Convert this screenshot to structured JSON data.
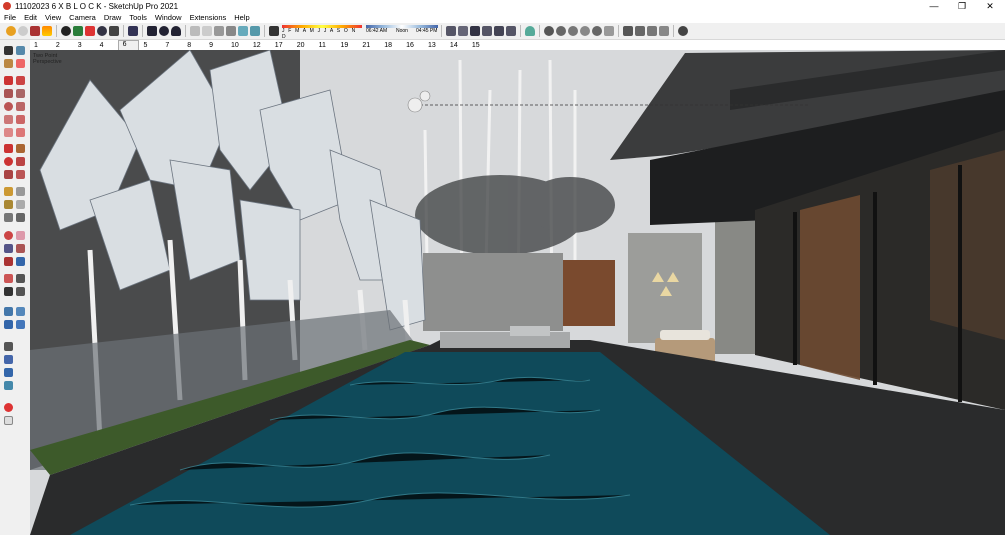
{
  "window": {
    "title": "11102023 6 X B L O C K - SketchUp Pro 2021",
    "controls": [
      "—",
      "❐",
      "✕"
    ]
  },
  "menu": [
    "File",
    "Edit",
    "View",
    "Camera",
    "Draw",
    "Tools",
    "Window",
    "Extensions",
    "Help"
  ],
  "shadow_settings": {
    "months": "J F M A M J J A S O N D",
    "time_start": "06:42 AM",
    "time_noon": "Noon",
    "time_end": "04:45 PM"
  },
  "scene_tabs": [
    "1",
    "2",
    "3",
    "4",
    "6",
    "5",
    "7",
    "8",
    "9",
    "10",
    "12",
    "17",
    "20",
    "11",
    "19",
    "21",
    "18",
    "16",
    "13",
    "14",
    "15"
  ],
  "active_scene": "6",
  "camera": {
    "line1": "Two Point",
    "line2": "Perspective"
  },
  "colors": {
    "sky": "#d7d9db",
    "pool_water": "#0f4a5a",
    "deck": "#2a2b2c",
    "grass": "#3d5a2a",
    "wall": "#4a4b4c"
  }
}
